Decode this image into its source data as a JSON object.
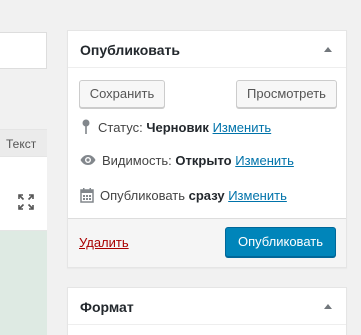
{
  "editor": {
    "tab_text": "Текст",
    "fullscreen_icon": "fullscreen-icon"
  },
  "publish": {
    "title": "Опубликовать",
    "save_label": "Сохранить",
    "preview_label": "Просмотреть",
    "status_label": "Статус:",
    "status_value": "Черновик",
    "visibility_label": "Видимость:",
    "visibility_value": "Открыто",
    "schedule_label": "Опубликовать",
    "schedule_value": "сразу",
    "edit_link": "Изменить",
    "trash_label": "Удалить",
    "publish_label": "Опубликовать"
  },
  "format": {
    "title": "Формат"
  },
  "colors": {
    "primary": "#0085ba",
    "link": "#0073aa",
    "danger": "#a00"
  }
}
